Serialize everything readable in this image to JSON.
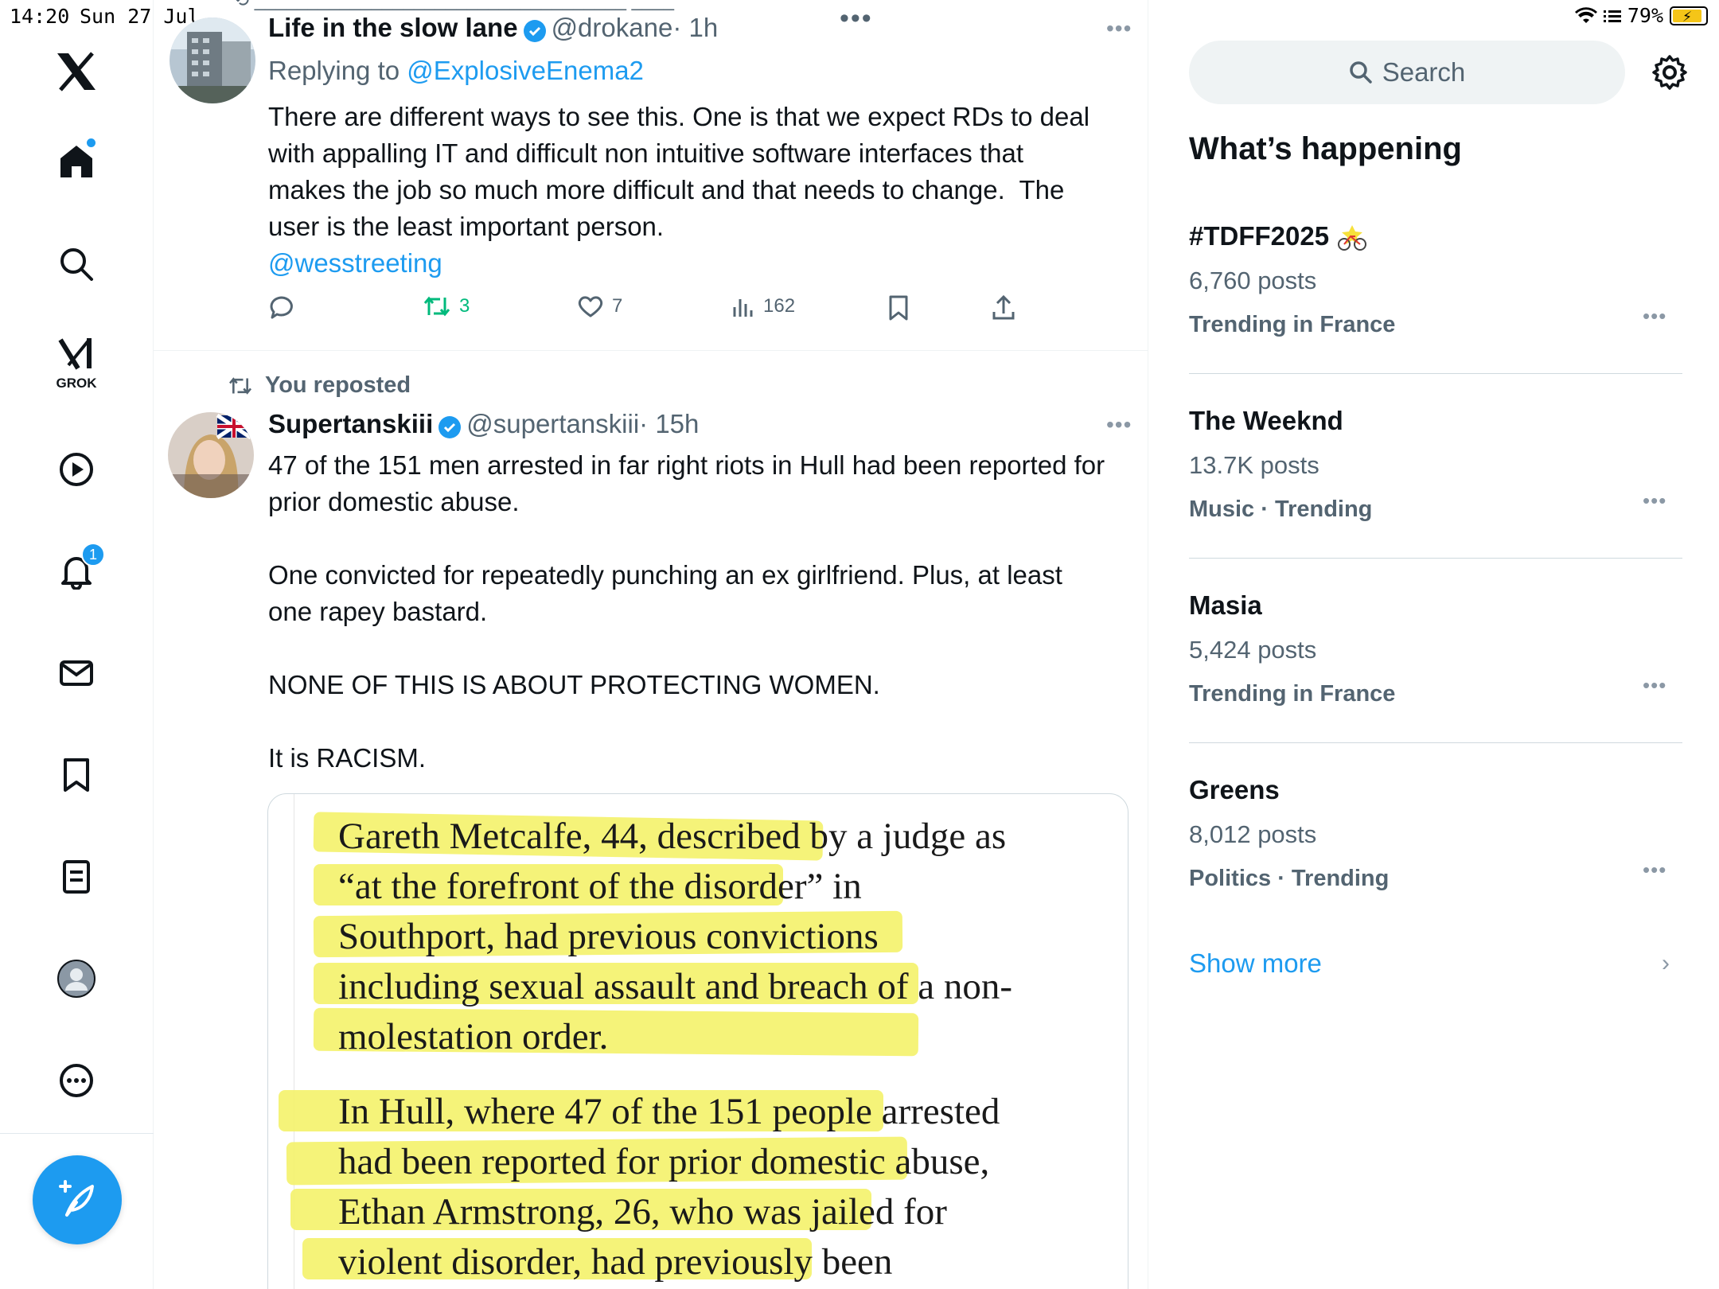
{
  "status_bar": {
    "time": "14:20",
    "date": "Sun 27 Jul",
    "battery": "79%"
  },
  "nav": {
    "notifications_badge": "1",
    "grok_label": "GROK",
    "items": [
      "home-icon",
      "search-icon",
      "grok-icon",
      "video-icon",
      "notifications-icon",
      "messages-icon",
      "bookmarks-icon",
      "lists-icon",
      "profile-icon",
      "more-icon"
    ]
  },
  "feed": {
    "tweet1": {
      "name": "Life in the slow lane",
      "handle": "@drokane",
      "time": "· 1h",
      "replying_prefix": "Replying to ",
      "replying_handle": "@ExplosiveEnema2",
      "text_lines": [
        "There are different ways to see this. One is that we expect RDs to deal",
        "with appalling IT and difficult non intuitive software interfaces that",
        "makes the job so much more difficult and that needs to change.  The",
        "user is the least important person."
      ],
      "mention": "@wesstreeting",
      "retweets": "3",
      "likes": "7",
      "views": "162"
    },
    "repost_label": "You reposted",
    "tweet2": {
      "name": "Supertanskiii",
      "handle": "@supertanskiii",
      "time": "· 15h",
      "text_lines": [
        "47 of the 151 men arrested in far right riots in Hull had been reported for",
        "prior domestic abuse.",
        "",
        "One convicted for repeatedly punching an ex girlfriend. Plus, at least",
        "one rapey bastard.",
        "",
        "NONE OF THIS IS ABOUT PROTECTING WOMEN.",
        "",
        "It is RACISM."
      ],
      "clipping_lines": [
        "Gareth Metcalfe, 44, described by a judge as",
        "“at the forefront of the disorder” in",
        "Southport, had previous convictions",
        "including sexual assault and breach of a non-",
        "molestation order.",
        "In Hull, where 47 of the 151 people arrested",
        "had been reported for prior domestic abuse,",
        "Ethan Armstrong, 26, who was jailed for",
        "violent disorder, had previously been"
      ]
    }
  },
  "right": {
    "search_placeholder": "Search",
    "section_title": "What’s happening",
    "trends": [
      {
        "name": "#TDFF2025",
        "posts": "6,760 posts",
        "context": "Trending in France"
      },
      {
        "name": "The Weeknd",
        "posts": "13.7K posts",
        "context": "Music · Trending"
      },
      {
        "name": "Masia",
        "posts": "5,424 posts",
        "context": "Trending in France"
      },
      {
        "name": "Greens",
        "posts": "8,012 posts",
        "context": "Politics · Trending"
      }
    ],
    "show_more": "Show more"
  },
  "colors": {
    "accent": "#1d9bf0",
    "retweet": "#00ba7c",
    "highlight": "#f4f26a"
  }
}
